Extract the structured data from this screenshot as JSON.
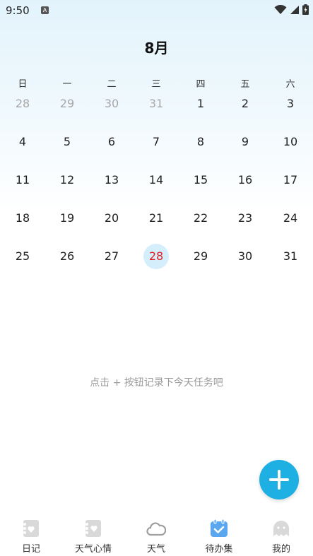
{
  "status": {
    "time": "9:50",
    "notification_icon": "A"
  },
  "calendar": {
    "month_title": "8月",
    "weekdays": [
      "日",
      "一",
      "二",
      "三",
      "四",
      "五",
      "六"
    ],
    "weeks": [
      [
        "28",
        "29",
        "30",
        "31",
        "1",
        "2",
        "3"
      ],
      [
        "4",
        "5",
        "6",
        "7",
        "8",
        "9",
        "10"
      ],
      [
        "11",
        "12",
        "13",
        "14",
        "15",
        "16",
        "17"
      ],
      [
        "18",
        "19",
        "20",
        "21",
        "22",
        "23",
        "24"
      ],
      [
        "25",
        "26",
        "27",
        "28",
        "29",
        "30",
        "31"
      ]
    ],
    "today": "28",
    "colors": {
      "today_text": "#e02020",
      "today_bg": "#d5eefb",
      "muted": "#a7a7a7"
    }
  },
  "empty_hint": "点击 + 按钮记录下今天任务吧",
  "fab": {
    "icon": "plus-icon",
    "color": "#1fb0e3"
  },
  "nav": {
    "items": [
      {
        "label": "日记",
        "icon": "diary-icon"
      },
      {
        "label": "天气心情",
        "icon": "weather-mood-icon"
      },
      {
        "label": "天气",
        "icon": "cloud-icon"
      },
      {
        "label": "待办集",
        "icon": "todo-icon",
        "active": true
      },
      {
        "label": "我的",
        "icon": "ghost-icon"
      }
    ],
    "active_color": "#5aa7ef"
  }
}
